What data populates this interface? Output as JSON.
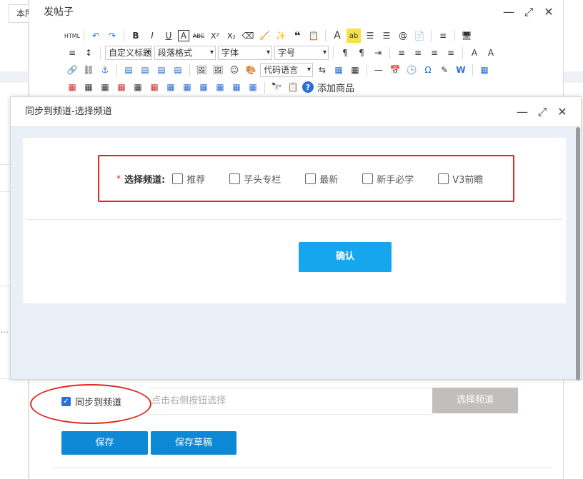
{
  "background": {
    "top_input_text": "本所",
    "dots": "…"
  },
  "editor": {
    "title": "发帖子",
    "toolbar": {
      "row1": [
        "HTML",
        "↶",
        "↷",
        "B",
        "I",
        "U",
        "A",
        "ABC",
        "X²",
        "X₂",
        "⌫",
        "🧹",
        "✨",
        "❝",
        "📋",
        "A",
        "ab",
        "☰",
        "☰",
        "@",
        "📄",
        "≡",
        "🖥"
      ],
      "row2_selects": [
        "自定义标题",
        "段落格式",
        "字体",
        "字号"
      ],
      "row2_icons": [
        "≡",
        "↕",
        "¶",
        "¶",
        "⇥",
        "≡",
        "≡",
        "≡",
        "≡",
        "A",
        "A"
      ],
      "row3_select": "代码语言",
      "row3_icons": [
        "🔗",
        "⛓",
        "⚓",
        "▤",
        "▤",
        "▤",
        "▤",
        "🖼",
        "🖼",
        "☺",
        "🎨",
        "⇆",
        "▦",
        "▦",
        "—",
        "📅",
        "🕒",
        "Ω",
        "✎",
        "W",
        "▦"
      ],
      "row4_icons": [
        "▦",
        "▦",
        "▦",
        "▦",
        "▦",
        "▦",
        "▦",
        "▦",
        "▦",
        "▦",
        "▦",
        "▦",
        "🔭",
        "📋",
        "?"
      ],
      "add_product": "添加商品"
    },
    "sync_label": "同步到频道",
    "sync_placeholder": "点击右侧按钮选择",
    "choose_channel": "选择频道",
    "save": "保存",
    "save_draft": "保存草稿"
  },
  "channel_dialog": {
    "title": "同步到频道-选择频道",
    "required_mark": "*",
    "label": "选择频道:",
    "options": [
      "推荐",
      "芋头专栏",
      "最新",
      "新手必学",
      "V3前瞻"
    ],
    "confirm": "确认"
  },
  "colors": {
    "primary_blue": "#0d89d6",
    "confirm_blue": "#16a6ee",
    "highlight_red": "#e0271f",
    "disabled_gray": "#c2bebe"
  }
}
